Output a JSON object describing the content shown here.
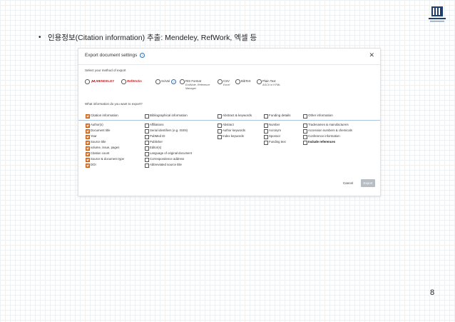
{
  "slide": {
    "bullet": "•",
    "title": "인용정보(Citation information) 추출: Mendeley, RefWork, 엑셀 등",
    "page_number": "8"
  },
  "dialog": {
    "title": "Export document settings",
    "help_glyph": "?",
    "close_glyph": "✕",
    "method_label": "Select your method of export",
    "methods": [
      {
        "name": "MENDELEY",
        "sub": ""
      },
      {
        "name": "RefWorks",
        "sub": ""
      },
      {
        "name": "SciVal",
        "sub": ""
      },
      {
        "name": "RIS Format",
        "sub": "EndNote, Reference Manager"
      },
      {
        "name": "CSV",
        "sub": "Excel"
      },
      {
        "name": "BibTeX",
        "sub": ""
      },
      {
        "name": "Plain Text",
        "sub": "ASCII in HTML"
      }
    ],
    "info_label": "What information do you want to export?",
    "columns": [
      {
        "header": "Citation information",
        "header_checked": true,
        "items": [
          {
            "label": "Author(s)",
            "checked": true
          },
          {
            "label": "Document title",
            "checked": true
          },
          {
            "label": "Year",
            "checked": true
          },
          {
            "label": "Source title",
            "checked": true
          },
          {
            "label": "volume, issue, pages",
            "checked": true
          },
          {
            "label": "Citation count",
            "checked": true
          },
          {
            "label": "Source & document type",
            "checked": true
          },
          {
            "label": "DOI",
            "checked": true
          }
        ]
      },
      {
        "header": "Bibliographical information",
        "header_checked": false,
        "items": [
          {
            "label": "Affiliations",
            "checked": false
          },
          {
            "label": "Serial identifiers (e.g. ISSN)",
            "checked": false
          },
          {
            "label": "PubMed ID",
            "checked": false
          },
          {
            "label": "Publisher",
            "checked": false
          },
          {
            "label": "Editor(s)",
            "checked": false
          },
          {
            "label": "Language of original document",
            "checked": false
          },
          {
            "label": "Correspondence address",
            "checked": false
          },
          {
            "label": "Abbreviated source title",
            "checked": false
          }
        ]
      },
      {
        "header": "Abstract & keywords",
        "header_checked": false,
        "items": [
          {
            "label": "Abstract",
            "checked": false
          },
          {
            "label": "Author keywords",
            "checked": false
          },
          {
            "label": "Index keywords",
            "checked": false
          }
        ]
      },
      {
        "header": "Funding details",
        "header_checked": false,
        "items": [
          {
            "label": "Number",
            "checked": false
          },
          {
            "label": "Acronym",
            "checked": false
          },
          {
            "label": "Sponsor",
            "checked": false
          },
          {
            "label": "Funding text",
            "checked": false
          }
        ]
      },
      {
        "header": "Other information",
        "header_checked": false,
        "items": [
          {
            "label": "Tradenames & manufacturers",
            "checked": false
          },
          {
            "label": "Accession numbers & chemicals",
            "checked": false
          },
          {
            "label": "Conference information",
            "checked": false
          },
          {
            "label": "Include references",
            "checked": false
          }
        ]
      }
    ],
    "cancel_label": "Cancel",
    "export_label": "Export"
  },
  "colors": {
    "checkbox_checked": "#e8833a",
    "accent_blue": "#2e6eb5",
    "export_disabled": "#b7bdc4"
  }
}
